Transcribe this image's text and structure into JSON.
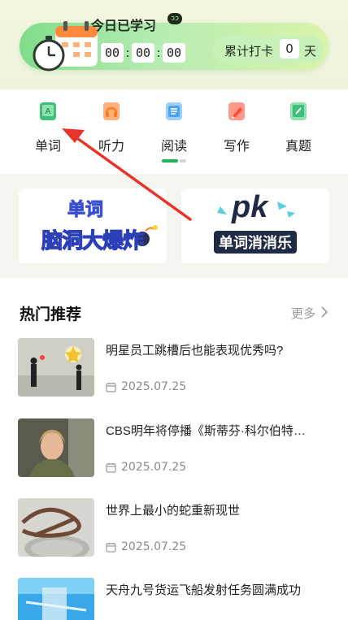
{
  "study": {
    "title": "今日已学习",
    "badge": "ↄↄ",
    "timer": {
      "h": "00",
      "m": "00",
      "s": "00",
      "sep": ":"
    },
    "checkin_label": "累计打卡",
    "checkin_count": "0",
    "checkin_unit": "天"
  },
  "categories": [
    {
      "label": "单词",
      "icon": "word-icon",
      "color": "#3ec07a"
    },
    {
      "label": "听力",
      "icon": "headphones-icon",
      "color": "#ff8f3a"
    },
    {
      "label": "阅读",
      "icon": "book-icon",
      "color": "#4aa3f0"
    },
    {
      "label": "写作",
      "icon": "pen-icon",
      "color": "#ff5a4a"
    },
    {
      "label": "真题",
      "icon": "exam-icon",
      "color": "#3ec07a"
    }
  ],
  "banners": [
    {
      "text_top": "单词",
      "text_bottom": "脑洞大爆炸"
    },
    {
      "text_top": "pk",
      "text_bottom": "单词消消乐"
    }
  ],
  "hot": {
    "title": "热门推荐",
    "more": "更多",
    "articles": [
      {
        "title": "明星员工跳槽后也能表现优秀吗?",
        "date": "2025.07.25"
      },
      {
        "title": "CBS明年将停播《斯蒂芬·科尔伯特…",
        "date": "2025.07.25"
      },
      {
        "title": "世界上最小的蛇重新现世",
        "date": "2025.07.25"
      },
      {
        "title": "天舟九号货运飞船发射任务圆满成功",
        "date": ""
      }
    ]
  },
  "colors": {
    "accent": "#23b45a",
    "annotation": "#e8332b"
  }
}
